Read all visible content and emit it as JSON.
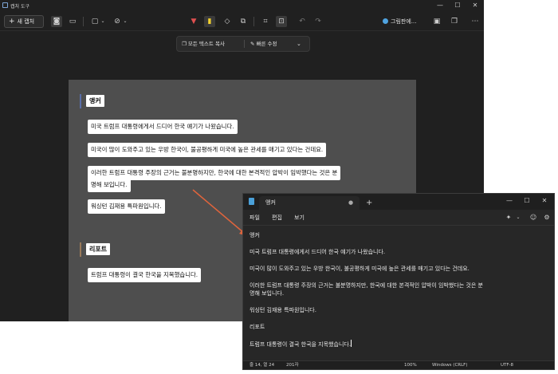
{
  "snipping_tool": {
    "title": "캡처 도구",
    "new_capture_label": "새 캡처",
    "paint_label": "그림판에...",
    "action_bar": {
      "copy_all_text": "모든 텍스트 복사",
      "quick_edit": "빠른 수정"
    },
    "capture": {
      "heading_anchor": "앵커",
      "lines": [
        "미국 트럼프 대통령에게서 드디어 한국 얘기가 나왔습니다.",
        "미국이 많이 도와주고 있는 우방 한국이, 불공평하게 미국에 높은 관세를 매기고 있다는 건데요.",
        "이러한 트럼프 대통령 주장의 근거는 불분명하지만, 한국에 대한 본격적인 압박이 임박했다는 것은 분",
        "명해 보입니다.",
        "워싱턴 김재용 특파원입니다."
      ],
      "heading_report": "리포트",
      "report_line": "트럼프 대통령이 결국 한국을 지목했습니다."
    },
    "colors": {
      "window_bg": "#202020",
      "capture_bg": "#4e4e4e",
      "anchor_bar": "#5a6ea8",
      "report_bar": "#9a7a5a",
      "arrow": "#e0643c"
    }
  },
  "notepad": {
    "tab_title": "앵커",
    "menu": [
      "파일",
      "편집",
      "보기"
    ],
    "content": [
      "앵커",
      "미국 트럼프 대통령에게서 드디어 한국 얘기가 나왔습니다.",
      "미국이 많이 도와주고 있는 우방 한국이, 불공평하게 미국에 높은 관세를 매기고 있다는 건데요.",
      "이러한 트럼프 대통령 주장의 근거는 불분명하지만, 한국에 대한 본격적인 압박이 임박했다는 것은 분",
      "명해 보입니다.",
      "워싱턴 김재용 특파원입니다.",
      "리포트",
      "트럼프 대통령이 결국 한국을 지목했습니다."
    ],
    "status": {
      "position": "줄 14, 열 24",
      "chars": "201자",
      "zoom": "100%",
      "line_ending": "Windows (CRLF)",
      "encoding": "UTF-8"
    }
  }
}
